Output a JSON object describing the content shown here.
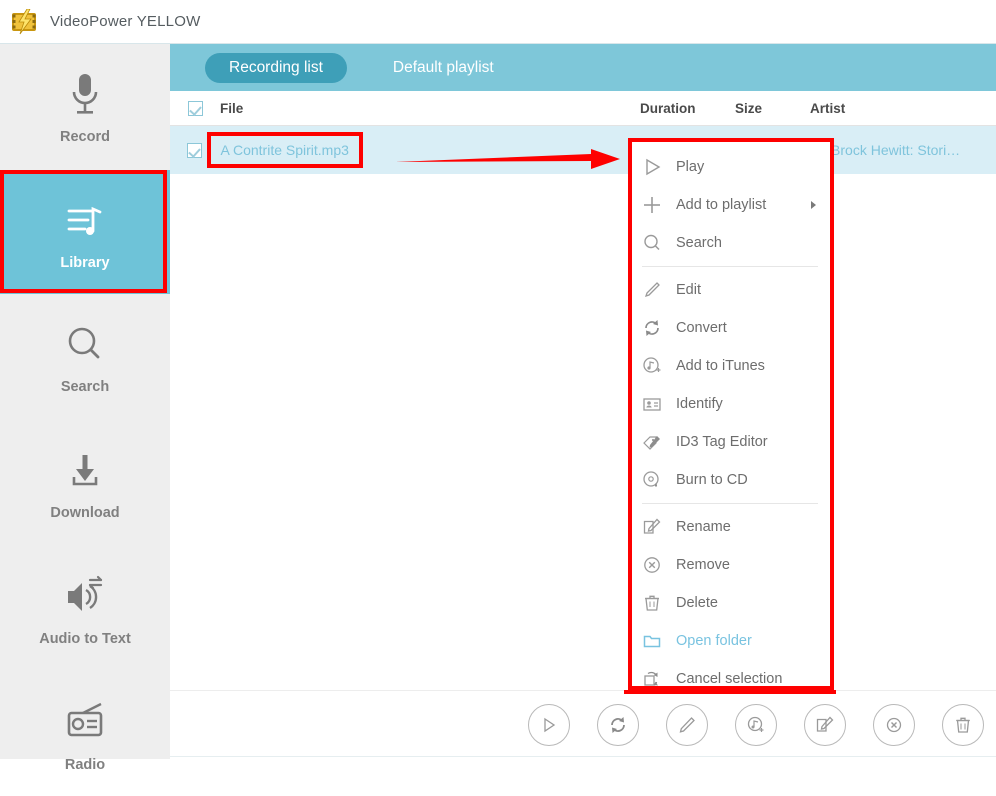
{
  "window": {
    "title": "VideoPower YELLOW",
    "app_icon": "lightning-film-icon",
    "accent": "#7ec7d9",
    "tab_active_bg": "#3e9fb8",
    "row_bg": "#d9eef6",
    "link_color": "#7fc4dc",
    "annotation_color": "#fe0000"
  },
  "sidebar": {
    "items": [
      {
        "label": "Record",
        "icon": "microphone-icon",
        "active": false
      },
      {
        "label": "Library",
        "icon": "playlist-note-icon",
        "active": true
      },
      {
        "label": "Search",
        "icon": "magnifier-icon",
        "active": false
      },
      {
        "label": "Download",
        "icon": "download-icon",
        "active": false
      },
      {
        "label": "Audio to Text",
        "icon": "speaker-swap-icon",
        "active": false
      },
      {
        "label": "Radio",
        "icon": "radio-icon",
        "active": false
      }
    ]
  },
  "tabs": [
    {
      "label": "Recording list",
      "active": true
    },
    {
      "label": "Default playlist",
      "active": false
    }
  ],
  "table": {
    "columns": [
      "File",
      "Duration",
      "Size",
      "Artist"
    ],
    "header_checkbox_checked": true,
    "rows": [
      {
        "checked": true,
        "file": "A Contrite Spirit.mp3",
        "duration": "",
        "size": "",
        "artist": "Brock Hewitt: Stori…"
      }
    ]
  },
  "context_menu": {
    "groups": [
      [
        {
          "label": "Play",
          "icon": "play-triangle-icon",
          "submenu": false,
          "link": false
        },
        {
          "label": "Add to playlist",
          "icon": "plus-icon",
          "submenu": true,
          "link": false
        },
        {
          "label": "Search",
          "icon": "magnifier-icon",
          "submenu": false,
          "link": false
        }
      ],
      [
        {
          "label": "Edit",
          "icon": "pencil-icon",
          "submenu": false,
          "link": false
        },
        {
          "label": "Convert",
          "icon": "convert-arrows-icon",
          "submenu": false,
          "link": false
        },
        {
          "label": "Add to iTunes",
          "icon": "note-circle-plus-icon",
          "submenu": false,
          "link": false
        },
        {
          "label": "Identify",
          "icon": "id-card-icon",
          "submenu": false,
          "link": false
        },
        {
          "label": "ID3 Tag Editor",
          "icon": "tag-pencil-icon",
          "submenu": false,
          "link": false
        },
        {
          "label": "Burn to CD",
          "icon": "cd-burn-icon",
          "submenu": false,
          "link": false
        }
      ],
      [
        {
          "label": "Rename",
          "icon": "rename-pencil-icon",
          "submenu": false,
          "link": false
        },
        {
          "label": "Remove",
          "icon": "circle-x-icon",
          "submenu": false,
          "link": false
        },
        {
          "label": "Delete",
          "icon": "trash-icon",
          "submenu": false,
          "link": false
        },
        {
          "label": "Open folder",
          "icon": "folder-icon",
          "submenu": false,
          "link": true
        },
        {
          "label": "Cancel selection",
          "icon": "cancel-selection-icon",
          "submenu": false,
          "link": false
        }
      ]
    ]
  },
  "footer": {
    "buttons": [
      {
        "name": "play-button",
        "icon": "play-triangle-icon"
      },
      {
        "name": "convert-button",
        "icon": "convert-arrows-icon"
      },
      {
        "name": "edit-button",
        "icon": "pencil-icon"
      },
      {
        "name": "add-to-itunes-button",
        "icon": "note-circle-plus-icon"
      },
      {
        "name": "id3-tag-button",
        "icon": "rename-pencil-icon"
      },
      {
        "name": "remove-button",
        "icon": "circle-x-icon"
      },
      {
        "name": "delete-button",
        "icon": "trash-icon"
      }
    ]
  }
}
